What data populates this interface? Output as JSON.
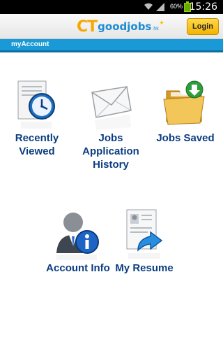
{
  "status_bar": {
    "battery_percent": "60%",
    "time": "15:26"
  },
  "header": {
    "logo": {
      "ct": "CT",
      "word": "goodjobs",
      "suffix": ".hk"
    },
    "login_label": "Login",
    "colors": {
      "header_bg": "#eeeeee",
      "login_bg": "#f7c51b",
      "accent": "#1999d5"
    }
  },
  "subheader": {
    "title": "myAccount"
  },
  "menu": {
    "items": [
      {
        "label": "Recently\nViewed",
        "icon": "clock-document-icon"
      },
      {
        "label": "Jobs\nApplication\nHistory",
        "icon": "envelope-icon"
      },
      {
        "label": "Jobs Saved",
        "icon": "folder-download-icon"
      },
      {
        "label": "Account Info",
        "icon": "user-info-icon"
      },
      {
        "label": "My Resume",
        "icon": "resume-upload-icon"
      }
    ],
    "label_color": "#0b3d80"
  }
}
